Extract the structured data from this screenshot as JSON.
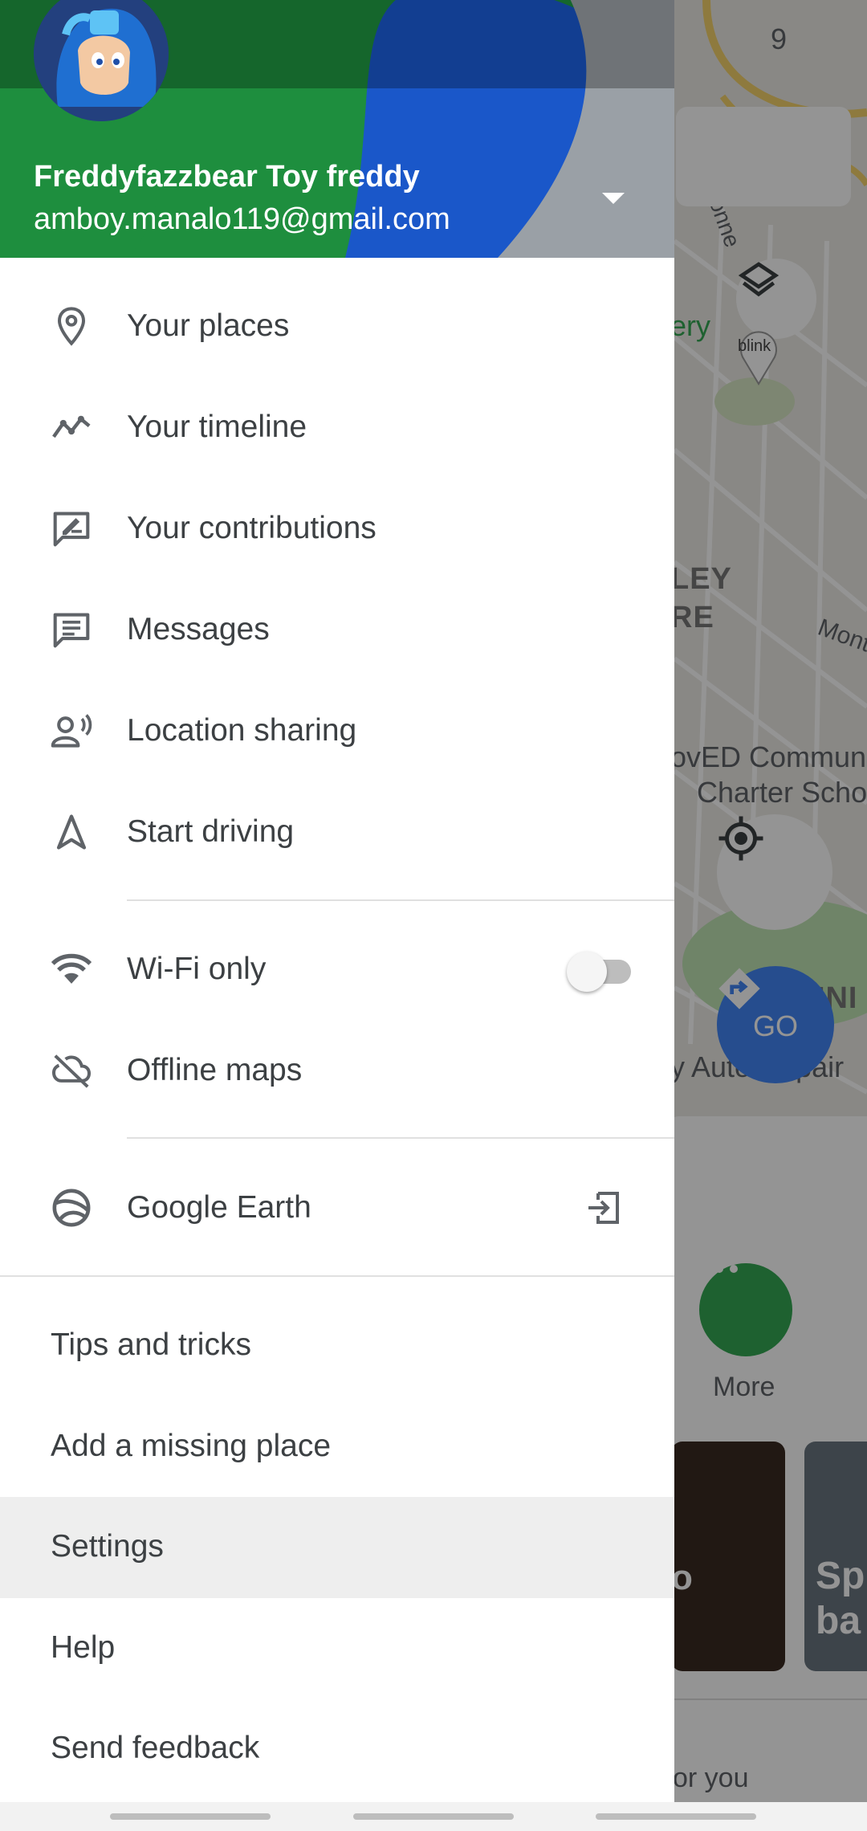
{
  "account": {
    "name": "Freddyfazzbear Toy freddy",
    "email": "amboy.manalo119@gmail.com"
  },
  "menu_primary": [
    {
      "label": "Your places",
      "icon": "place-pin-icon"
    },
    {
      "label": "Your timeline",
      "icon": "timeline-icon"
    },
    {
      "label": "Your contributions",
      "icon": "contributions-icon"
    },
    {
      "label": "Messages",
      "icon": "messages-icon"
    },
    {
      "label": "Location sharing",
      "icon": "location-sharing-icon"
    },
    {
      "label": "Start driving",
      "icon": "navigation-arrow-icon"
    }
  ],
  "menu_settings": {
    "wifi_only": {
      "label": "Wi-Fi only",
      "icon": "wifi-icon",
      "enabled": false
    },
    "offline_maps": {
      "label": "Offline maps",
      "icon": "cloud-off-icon"
    }
  },
  "google_earth": {
    "label": "Google Earth",
    "icon": "google-earth-icon",
    "trailing_icon": "open-external-icon"
  },
  "menu_text_items": [
    {
      "label": "Tips and tricks",
      "selected": false
    },
    {
      "label": "Add a missing place",
      "selected": false
    },
    {
      "label": "Settings",
      "selected": true
    },
    {
      "label": "Help",
      "selected": false
    },
    {
      "label": "Send feedback",
      "selected": false
    }
  ],
  "map": {
    "route_shield": "9",
    "street_label": "Tonne",
    "street_label_2": "Mont",
    "poi_label": "ery",
    "district_line1": "LEY",
    "district_line2": "RE",
    "school_line1": "ovED Communi",
    "school_line2": "Charter Scho",
    "poi_pin": "blink",
    "area_label": "UNI",
    "shop_label": "y Auto Repair",
    "go_label": "GO",
    "more_label": "More",
    "photo_caption_line1": "Sp",
    "photo_caption_line2": "ba",
    "photo1_letter": "o",
    "foryou_label": "or you"
  },
  "colors": {
    "google_blue": "#4285f4",
    "google_red": "#ea4335",
    "google_yellow": "#fbbc04",
    "google_green": "#34a853",
    "selected_row": "#eeeeee"
  }
}
